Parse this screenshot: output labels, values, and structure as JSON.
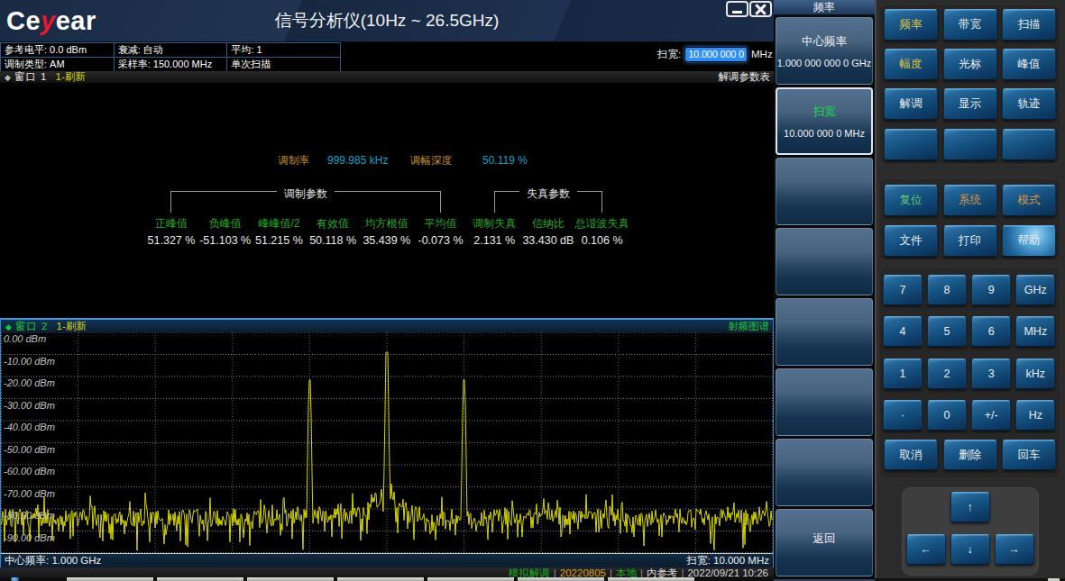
{
  "header": {
    "logo_prefix": "Ce",
    "logo_accent": "y",
    "logo_suffix": "ear",
    "title": "信号分析仪(10Hz ~ 26.5GHz)",
    "minimize_icon": "minimize-bar-icon",
    "close_icon": "close-x-icon"
  },
  "param_table": {
    "rows": [
      [
        "参考电平: 0.0 dBm",
        "衰减: 自动",
        "平均: 1"
      ],
      [
        "调制类型: AM",
        "采样率: 150.000 MHz",
        "单次扫描"
      ]
    ]
  },
  "span_entry": {
    "label": "扫宽:",
    "value": "10.000 000 0",
    "unit": "MHz"
  },
  "window1": {
    "marker": "◆",
    "name": "窗口 1",
    "refresh": "1-刷新",
    "view_label": "解调参数表",
    "mod_rate_label": "调制率",
    "mod_rate_value": "999.985 kHz",
    "mod_depth_label": "调幅深度",
    "mod_depth_value": "50.119 %",
    "group_mod_label": "调制参数",
    "group_dist_label": "失真参数",
    "columns": [
      {
        "name": "正峰值",
        "value": "51.327 %"
      },
      {
        "name": "负峰值",
        "value": "-51.103 %"
      },
      {
        "name": "峰峰值/2",
        "value": "51.215 %"
      },
      {
        "name": "有效值",
        "value": "50.118 %"
      },
      {
        "name": "均方根值",
        "value": "35.439 %"
      },
      {
        "name": "平均值",
        "value": "-0.073 %"
      },
      {
        "name": "调制失真",
        "value": "2.131 %"
      },
      {
        "name": "信纳比",
        "value": "33.430 dB"
      },
      {
        "name": "总谐波失真",
        "value": "0.106 %"
      }
    ]
  },
  "window2": {
    "marker": "◆",
    "name": "窗口 2",
    "refresh": "1-刷新",
    "view_label": "射频图谱",
    "center_freq": "中心频率: 1.000 GHz",
    "span": "扫宽: 10.000 MHz"
  },
  "chart_data": {
    "type": "line",
    "title": "射频图谱",
    "ylabel": "dBm",
    "ylim": [
      -100,
      0
    ],
    "xlim_desc": {
      "center": "1.000 GHz",
      "span": "10.000 MHz"
    },
    "y_ticks": [
      "0.00 dBm",
      "-10.00 dBm",
      "-20.00 dBm",
      "-30.00 dBm",
      "-40.00 dBm",
      "-50.00 dBm",
      "-60.00 dBm",
      "-70.00 dBm",
      "-80.00 dBm",
      "-90.00 dBm"
    ],
    "grid": {
      "x_divisions": 10,
      "y_divisions": 10
    },
    "noise_floor_dbm": -84,
    "peaks": [
      {
        "x_div": 4,
        "dbm": -21.5,
        "desc": "lower AM sideband"
      },
      {
        "x_div": 5,
        "dbm": -9.0,
        "desc": "carrier 1.000 GHz"
      },
      {
        "x_div": 6,
        "dbm": -21.5,
        "desc": "upper AM sideband"
      }
    ],
    "trace_color": "#d6d600",
    "seed": 20220921
  },
  "status_bar": {
    "mode": "模拟解调",
    "build": "20220805",
    "source": "本地",
    "reference": "内参考",
    "datetime": "2022/09/21 10:26",
    "separator": "|"
  },
  "menu": {
    "title": "频率",
    "buttons": [
      {
        "label": "中心频率",
        "value": "1.000 000 000 0 GHz",
        "selected": false
      },
      {
        "label": "扫宽",
        "value": "10.000 000 0 MHz",
        "selected": true
      },
      {
        "label": "",
        "value": "",
        "selected": false
      },
      {
        "label": "",
        "value": "",
        "selected": false
      },
      {
        "label": "",
        "value": "",
        "selected": false
      },
      {
        "label": "",
        "value": "",
        "selected": false
      },
      {
        "label": "",
        "value": "",
        "selected": false
      },
      {
        "label": "返回",
        "value": "",
        "selected": false
      }
    ]
  },
  "keypad": {
    "function_keys": [
      [
        {
          "label": "频率",
          "color": "yellow"
        },
        {
          "label": "带宽",
          "color": ""
        },
        {
          "label": "扫描",
          "color": ""
        }
      ],
      [
        {
          "label": "幅度",
          "color": "yellow"
        },
        {
          "label": "光标",
          "color": ""
        },
        {
          "label": "峰值",
          "color": ""
        }
      ],
      [
        {
          "label": "解调",
          "color": ""
        },
        {
          "label": "显示",
          "color": ""
        },
        {
          "label": "轨迹",
          "color": ""
        }
      ],
      [
        {
          "label": "",
          "color": ""
        },
        {
          "label": "",
          "color": ""
        },
        {
          "label": "",
          "color": ""
        }
      ]
    ],
    "system_keys": [
      [
        {
          "label": "复位",
          "color": "green"
        },
        {
          "label": "系统",
          "color": "orange"
        },
        {
          "label": "模式",
          "color": "orange"
        }
      ],
      [
        {
          "label": "文件",
          "color": ""
        },
        {
          "label": "打印",
          "color": ""
        },
        {
          "label": "帮助",
          "color": "hl"
        }
      ]
    ],
    "numpad": [
      [
        "7",
        "8",
        "9",
        "GHz"
      ],
      [
        "4",
        "5",
        "6",
        "MHz"
      ],
      [
        "1",
        "2",
        "3",
        "kHz"
      ],
      [
        "·",
        "0",
        "+/-",
        "Hz"
      ]
    ],
    "edit_keys": [
      "取消",
      "删除",
      "回车"
    ],
    "arrows": {
      "up": "↑",
      "left": "←",
      "down": "↓",
      "right": "→"
    }
  }
}
